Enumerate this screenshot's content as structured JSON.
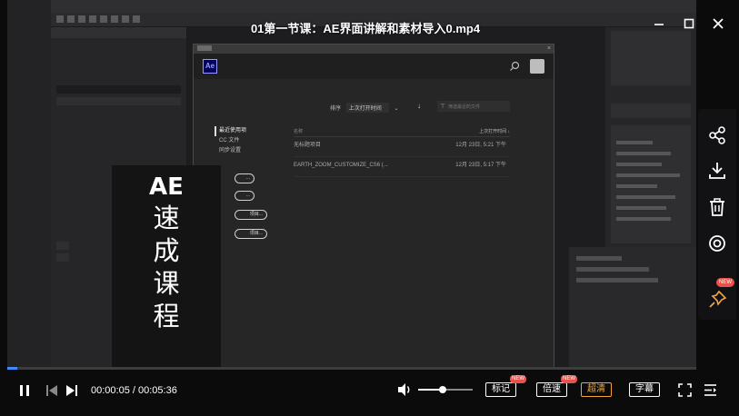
{
  "video": {
    "title": "01第一节课：AE界面讲解和素材导入0.mp4"
  },
  "ae_start_dialog": {
    "logo": "Ae",
    "sort_label": "排序",
    "sort_value": "上次打开时间",
    "filter_placeholder": "筛选最近的文件",
    "sidebar_links": [
      "最近使用项",
      "CC 文件",
      "同步设置"
    ],
    "col_name": "名称",
    "col_last_opened": "上次打开时间",
    "rows": [
      {
        "name": "无标题项目",
        "date": "12月 23日, 5:21 下午"
      },
      {
        "name": "EARTH_ZOOM_CUSTOMIZE_CS6 (...",
        "date": "12月 23日, 5:17 下午"
      }
    ],
    "pill_buttons": [
      "...",
      "...",
      "项目...",
      "项目..."
    ]
  },
  "promo": {
    "line1": "AE",
    "chars": [
      "速",
      "成",
      "课",
      "程"
    ]
  },
  "side_toolbar": {
    "icons": [
      "share-icon",
      "download-icon",
      "trash-icon",
      "target-icon",
      "pin-icon"
    ],
    "new_badge": "NEW"
  },
  "player": {
    "time_current": "00:00:05",
    "time_separator": " / ",
    "time_total": "00:05:36",
    "progress": 0.015,
    "volume": 0.45,
    "buttons": {
      "mark": "标记",
      "speed": "倍速",
      "quality": "超清",
      "subtitle": "字幕"
    },
    "new_badge": "NEW",
    "accent_color": "#f5a33b",
    "progress_color": "#3d8cff"
  }
}
